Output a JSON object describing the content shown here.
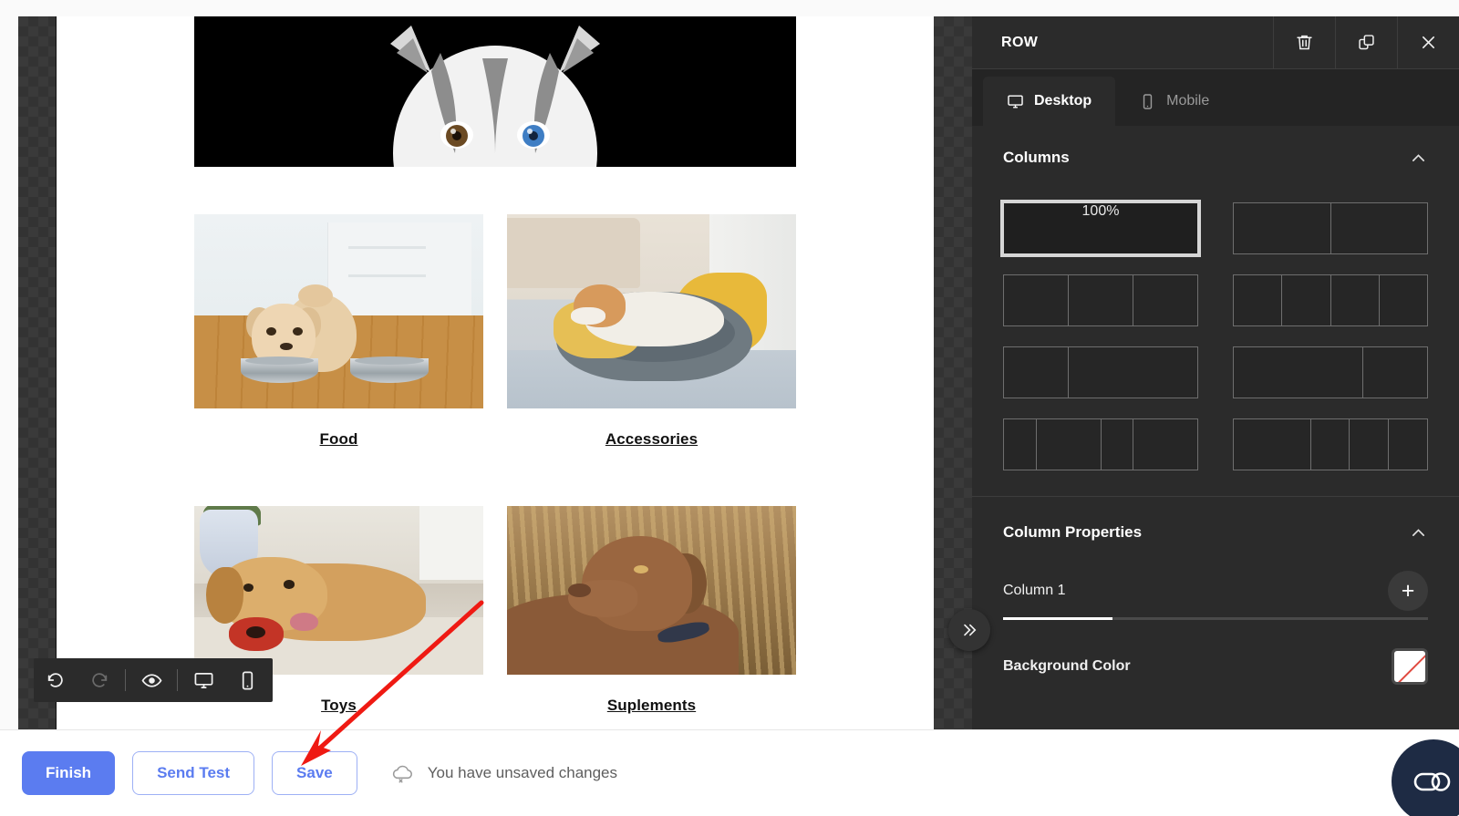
{
  "panel": {
    "title": "ROW",
    "header_buttons": [
      {
        "name": "delete-row-button",
        "icon": "trash-icon"
      },
      {
        "name": "duplicate-row-button",
        "icon": "duplicate-icon"
      },
      {
        "name": "close-panel-button",
        "icon": "close-icon"
      }
    ],
    "tabs": [
      {
        "label": "Desktop",
        "icon": "desktop-icon",
        "active": true
      },
      {
        "label": "Mobile",
        "icon": "mobile-icon",
        "active": false
      }
    ],
    "columns_section": {
      "title": "Columns",
      "collapse_icon": "chevron-up-icon",
      "selected_label": "100%",
      "options": [
        {
          "id": "one-col",
          "segments": [
            1
          ],
          "label": "100%",
          "selected": true
        },
        {
          "id": "two-col",
          "segments": [
            1,
            1
          ],
          "label": "",
          "selected": false
        },
        {
          "id": "three-col",
          "segments": [
            1,
            1,
            1
          ],
          "label": "",
          "selected": false
        },
        {
          "id": "four-col",
          "segments": [
            1,
            1,
            1,
            1
          ],
          "label": "",
          "selected": false
        },
        {
          "id": "one-third-two-thirds",
          "segments": [
            1,
            2
          ],
          "label": "",
          "selected": false
        },
        {
          "id": "two-thirds-one-third",
          "segments": [
            2,
            1
          ],
          "label": "",
          "selected": false
        },
        {
          "id": "small-large-small-large",
          "segments": [
            1,
            2,
            1,
            2
          ],
          "label": "",
          "selected": false
        },
        {
          "id": "large-small-small-small",
          "segments": [
            2,
            1,
            1,
            1
          ],
          "label": "",
          "selected": false
        }
      ]
    },
    "column_properties": {
      "title": "Column Properties",
      "collapse_icon": "chevron-up-icon",
      "active_tab": "Column 1",
      "add_button_label": "+",
      "background_color_label": "Background Color",
      "background_color_value": "transparent"
    },
    "collapse_sidebar_icon": "chevron-double-right-icon"
  },
  "canvas": {
    "banner": {
      "alt": "husky-banner"
    },
    "categories": [
      {
        "label": "Food",
        "image": "puppy-with-bowls"
      },
      {
        "label": "Accessories",
        "image": "dog-in-pet-bed"
      },
      {
        "label": "Toys",
        "image": "puppy-with-red-toy"
      },
      {
        "label": "Suplements",
        "image": "labrador-in-field"
      }
    ],
    "toolbar": [
      {
        "name": "undo-button",
        "icon": "undo-icon",
        "enabled": true
      },
      {
        "name": "redo-button",
        "icon": "redo-icon",
        "enabled": false
      },
      {
        "name": "preview-button",
        "icon": "eye-icon",
        "enabled": true
      },
      {
        "name": "desktop-view-button",
        "icon": "desktop-icon",
        "enabled": true
      },
      {
        "name": "mobile-view-button",
        "icon": "mobile-icon",
        "enabled": true
      }
    ]
  },
  "bottom_bar": {
    "finish_label": "Finish",
    "send_test_label": "Send Test",
    "save_label": "Save",
    "status_text": "You have unsaved changes",
    "status_icon": "cloud-off-icon",
    "chat_widget_label": "CO"
  },
  "colors": {
    "accent": "#5b7cf0",
    "panel_bg": "#2b2b2b",
    "panel_tabbar_bg": "#242424",
    "annotation_red": "#ef1a13",
    "chat_widget_bg": "#1e2b44"
  }
}
